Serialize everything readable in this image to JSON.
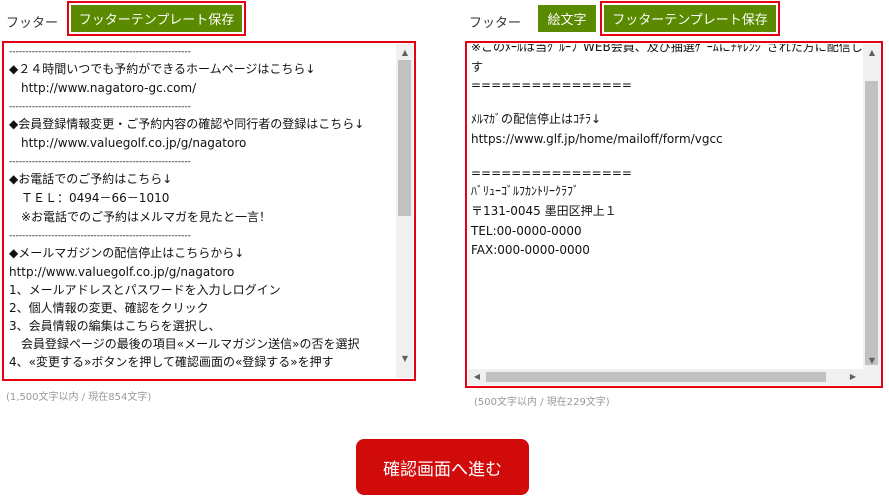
{
  "left": {
    "label": "フッター",
    "template_save": "フッターテンプレート保存",
    "lines": [
      "--------------------------------------------------------",
      "◆２４時間いつでも予約ができるホームページはこちら↓",
      "　http://www.nagatoro-gc.com/",
      "--------------------------------------------------------",
      "◆会員登録情報変更・ご予約内容の確認や同行者の登録はこちら↓",
      "　http://www.valuegolf.co.jp/g/nagatoro",
      "--------------------------------------------------------",
      "◆お電話でのご予約はこちら↓",
      "　ＴＥＬ：0494－66－1010",
      "　※お電話でのご予約はメルマガを見たと一言！",
      "--------------------------------------------------------",
      "◆メールマガジンの配信停止はこちらから↓",
      "http://www.valuegolf.co.jp/g/nagatoro",
      "1、メールアドレスとパスワードを入力しログイン",
      "2、個人情報の変更、確認をクリック",
      "3、会員情報の編集はこちらを選択し、",
      "　会員登録ページの最後の項目«メールマガジン送信»の否を選択",
      "4、«変更する»ボタンを押して確認画面の«登録する»を押す"
    ],
    "counter": "(1,500文字以内 / 現在854文字)"
  },
  "right": {
    "label": "フッター",
    "emoji_button": "絵文字",
    "template_save": "フッターテンプレート保存",
    "lines": [
      "※このﾒｰﾙは当ｸﾞﾙｰﾌﾟWEB会員、及び抽選ｹﾞｰﾑにﾁｬﾚﾝｼﾞされた方に配信しておりま",
      "す",
      "================",
      "",
      "ﾒﾙﾏｶﾞの配信停止はｺﾁﾗ↓",
      "https://www.glf.jp/home/mailoff/form/vgcc",
      "",
      "================",
      "ﾊﾞﾘｭｰｺﾞﾙﾌｶﾝﾄﾘｰｸﾗﾌﾞ",
      "〒131-0045 墨田区押上１",
      "TEL:00-0000-0000",
      "FAX:000-0000-0000"
    ],
    "counter": "(500文字以内 / 現在229文字)"
  },
  "confirm_button": "確認画面へ進む"
}
